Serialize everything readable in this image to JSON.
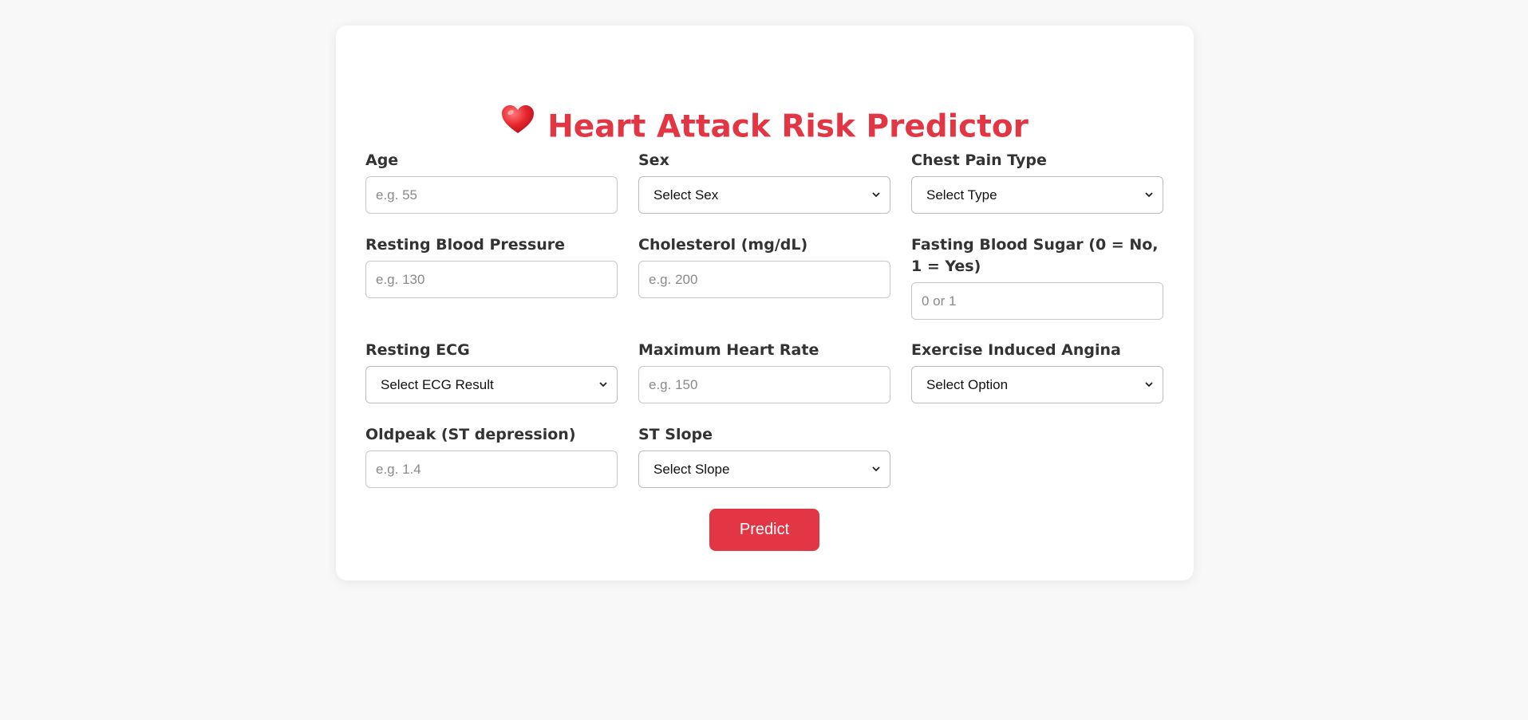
{
  "header": {
    "title": "Heart Attack Risk Predictor",
    "icon": "heart-icon"
  },
  "fields": {
    "age": {
      "label": "Age",
      "placeholder": "e.g. 55"
    },
    "sex": {
      "label": "Sex",
      "selected": "Select Sex"
    },
    "chest_pain": {
      "label": "Chest Pain Type",
      "selected": "Select Type"
    },
    "resting_bp": {
      "label": "Resting Blood Pressure",
      "placeholder": "e.g. 130"
    },
    "cholesterol": {
      "label": "Cholesterol (mg/dL)",
      "placeholder": "e.g. 200"
    },
    "fasting_bs": {
      "label": "Fasting Blood Sugar (0 = No, 1 = Yes)",
      "placeholder": "0 or 1"
    },
    "resting_ecg": {
      "label": "Resting ECG",
      "selected": "Select ECG Result"
    },
    "max_hr": {
      "label": "Maximum Heart Rate",
      "placeholder": "e.g. 150"
    },
    "exercise_angina": {
      "label": "Exercise Induced Angina",
      "selected": "Select Option"
    },
    "oldpeak": {
      "label": "Oldpeak (ST depression)",
      "placeholder": "e.g. 1.4"
    },
    "st_slope": {
      "label": "ST Slope",
      "selected": "Select Slope"
    }
  },
  "actions": {
    "predict_label": "Predict"
  },
  "colors": {
    "accent": "#e23645",
    "background": "#f8f8f8",
    "card": "#ffffff",
    "label": "#333333"
  }
}
